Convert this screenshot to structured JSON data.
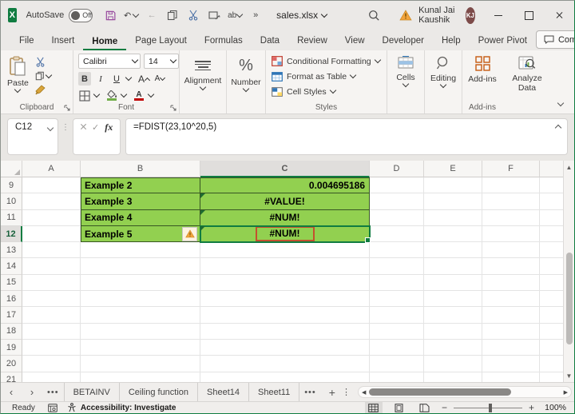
{
  "colors": {
    "accent_green": "#107C41",
    "cell_fill_green": "#92D050",
    "cell_border_green": "#375623",
    "annotation_red": "#C4502E",
    "warning_orange": "#F2A33C",
    "avatar_brown": "#7D4B49",
    "save_icon_purple": "#9A4FA0",
    "addins_orange": "#C55A11"
  },
  "titlebar": {
    "autosave_label": "AutoSave",
    "autosave_state": "Off",
    "filename": "sales.xlsx",
    "user_name": "Kunal Jai Kaushik",
    "user_initials": "KJ"
  },
  "ribbon_tabs": [
    "File",
    "Insert",
    "Home",
    "Page Layout",
    "Formulas",
    "Data",
    "Review",
    "View",
    "Developer",
    "Help",
    "Power Pivot"
  ],
  "active_tab": "Home",
  "comments_label": "Comments",
  "ribbon": {
    "paste_label": "Paste",
    "clipboard_group_label": "Clipboard",
    "font_name": "Calibri",
    "font_size": "14",
    "bold_label": "B",
    "italic_label": "I",
    "underline_label": "U",
    "font_grow_label": "A",
    "font_shrink_label": "A",
    "font_color_label": "A",
    "font_group_label": "Font",
    "alignment_label": "Alignment",
    "number_label": "Number",
    "conditional_formatting_label": "Conditional Formatting",
    "format_as_table_label": "Format as Table",
    "cell_styles_label": "Cell Styles",
    "styles_group_label": "Styles",
    "cells_label": "Cells",
    "editing_label": "Editing",
    "addins_label": "Add-ins",
    "analyze_data_label_1": "Analyze",
    "analyze_data_label_2": "Data",
    "addins_group_label": "Add-ins"
  },
  "formula_bar": {
    "name_box": "C12",
    "fx_label": "fx",
    "formula": "=FDIST(23,10^20,5)"
  },
  "grid": {
    "columns": [
      "A",
      "B",
      "C",
      "D",
      "E",
      "F"
    ],
    "rows": [
      9,
      10,
      11,
      12,
      13,
      14,
      15,
      16,
      17,
      18,
      19,
      20,
      21
    ],
    "selected_column": "C",
    "selected_row": 12,
    "cells": [
      {
        "row": 9,
        "label": "Example 2",
        "value": "0.004695186",
        "value_align": "right"
      },
      {
        "row": 10,
        "label": "Example 3",
        "value": "#VALUE!",
        "value_align": "center",
        "error_indicator": true
      },
      {
        "row": 11,
        "label": "Example 4",
        "value": "#NUM!",
        "value_align": "center",
        "error_indicator": true
      },
      {
        "row": 12,
        "label": "Example 5",
        "value": "#NUM!",
        "value_align": "center",
        "error_indicator": true,
        "warning_icon": true,
        "annotated": true,
        "selected": true
      }
    ]
  },
  "sheet_tabs": [
    "BETAINV",
    "Ceiling function",
    "Sheet14",
    "Sheet11"
  ],
  "status_bar": {
    "ready_label": "Ready",
    "accessibility_label": "Accessibility: Investigate",
    "zoom_level": "100%"
  },
  "glyphs": {
    "more": "»",
    "undo": "↶",
    "back": "←",
    "prev": "‹",
    "next": "›",
    "dots": "•••",
    "ellipsis_v": "⋮",
    "up": "▲",
    "down": "▼",
    "left": "◀",
    "right": "▶",
    "plus": "+",
    "minus": "−",
    "percent": "%",
    "check": "✓",
    "ab": "ab"
  }
}
